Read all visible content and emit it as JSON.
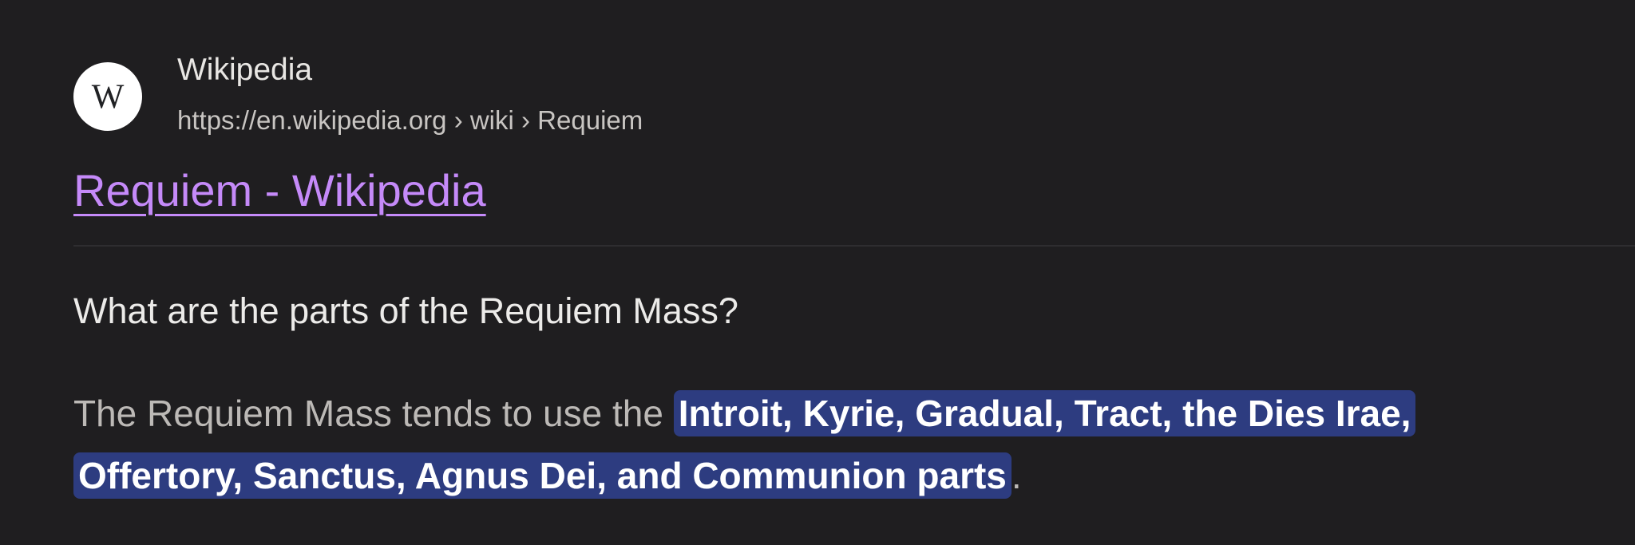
{
  "result": {
    "favicon_icon": "wikipedia-w-icon",
    "favicon_letter": "W",
    "site_name": "Wikipedia",
    "url": "https://en.wikipedia.org › wiki › Requiem",
    "title": "Requiem - Wikipedia",
    "question": "What are the parts of the Requiem Mass?",
    "snippet_prefix": "The Requiem Mass tends to use the ",
    "snippet_highlight_line1": "Introit, Kyrie, Gradual, Tract, the Dies Irae,",
    "snippet_highlight_line2": "Offertory, Sanctus, Agnus Dei, and Communion parts",
    "snippet_suffix": "."
  },
  "colors": {
    "background": "#1f1e20",
    "title_link": "#c58af9",
    "highlight_bg": "#2d3c80"
  }
}
